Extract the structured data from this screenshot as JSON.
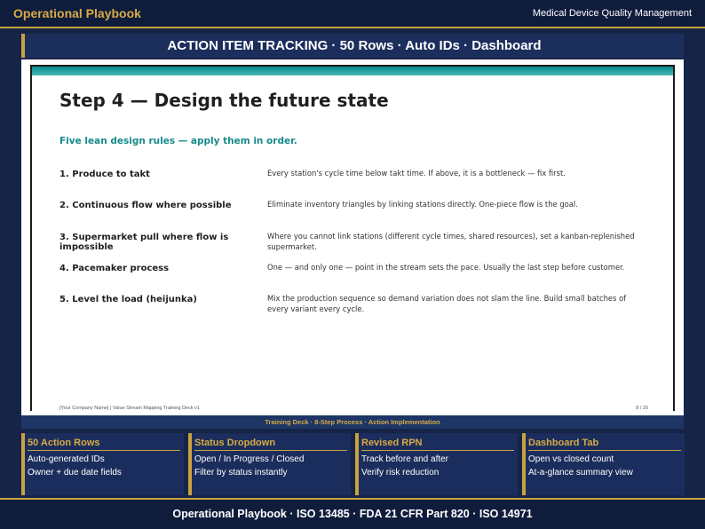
{
  "header": {
    "brand": "Operational Playbook",
    "context": "Medical Device Quality Management"
  },
  "banner": {
    "text": "ACTION ITEM TRACKING  ·  50 Rows  ·  Auto IDs  ·  Dashboard"
  },
  "slide": {
    "title": "Step 4 — Design the future state",
    "subtitle": "Five lean design rules — apply them in order.",
    "rules": [
      {
        "name": "1. Produce to takt",
        "desc": "Every station's cycle time below takt time. If above, it is a bottleneck — fix first."
      },
      {
        "name": "2. Continuous flow where possible",
        "desc": "Eliminate inventory triangles by linking stations directly. One-piece flow is the goal."
      },
      {
        "name": "3. Supermarket pull where flow is impossible",
        "desc": "Where you cannot link stations (different cycle times, shared resources), set a kanban-replenished supermarket."
      },
      {
        "name": "4. Pacemaker process",
        "desc": "One — and only one — point in the stream sets the pace. Usually the last step before customer."
      },
      {
        "name": "5. Level the load (heijunka)",
        "desc": "Mix the production sequence so demand variation does not slam the line. Build small batches of every variant every cycle."
      }
    ],
    "footer_left": "[Your Company Name]   |   Value Stream Mapping Training Deck v1",
    "footer_right": "8 / 20"
  },
  "strip": {
    "text": "Training Deck · 8-Step Process  ·  Action Implementation"
  },
  "cards": [
    {
      "title": "50 Action Rows",
      "items": [
        "Auto-generated IDs",
        "Owner + due date fields"
      ]
    },
    {
      "title": "Status Dropdown",
      "items": [
        "Open / In Progress / Closed",
        "Filter by status instantly"
      ]
    },
    {
      "title": "Revised RPN",
      "items": [
        "Track before and after",
        "Verify risk reduction"
      ]
    },
    {
      "title": "Dashboard Tab",
      "items": [
        "Open vs closed count",
        "At-a-glance summary view"
      ]
    }
  ],
  "bottom": {
    "text": "Operational Playbook  ·  ISO 13485  ·  FDA 21 CFR Part 820  ·  ISO 14971"
  }
}
